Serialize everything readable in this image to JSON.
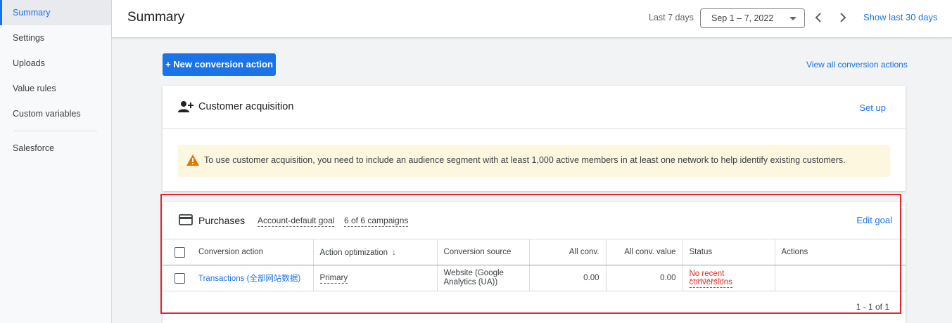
{
  "sidebar": {
    "items": [
      {
        "label": "Summary",
        "active": true
      },
      {
        "label": "Settings"
      },
      {
        "label": "Uploads"
      },
      {
        "label": "Value rules"
      },
      {
        "label": "Custom variables"
      }
    ],
    "extra_items": [
      {
        "label": "Salesforce"
      }
    ]
  },
  "header": {
    "title": "Summary",
    "range_label": "Last 7 days",
    "date_range": "Sep 1 – 7, 2022",
    "show_last_30": "Show last 30 days"
  },
  "actions": {
    "new_conversion": "+ New conversion action",
    "view_all": "View all conversion actions"
  },
  "customer_acquisition": {
    "title": "Customer acquisition",
    "setup_link": "Set up",
    "warning": "To use customer acquisition, you need to include an audience segment with at least 1,000 active members in at least one network to help identify existing customers."
  },
  "purchases": {
    "title": "Purchases",
    "goal_chip": "Account-default goal",
    "campaigns_chip": "6 of 6 campaigns",
    "edit_goal": "Edit goal",
    "columns": [
      "Conversion action",
      "Action optimization",
      "Conversion source",
      "All conv.",
      "All conv. value",
      "Status",
      "Actions"
    ],
    "rows": [
      {
        "action": "Transactions (全部网站数据)",
        "optimization": "Primary",
        "source": "Website (Google Analytics (UA))",
        "all_conv": "0.00",
        "all_conv_value": "0.00",
        "status": "No recent conversions",
        "actions": ""
      }
    ],
    "pagination": "1 - 1 of 1"
  },
  "colors": {
    "accent": "#1a73e8",
    "warning_bg": "#fef7e0",
    "status_red": "#d93025",
    "highlight": "#e8262d"
  }
}
